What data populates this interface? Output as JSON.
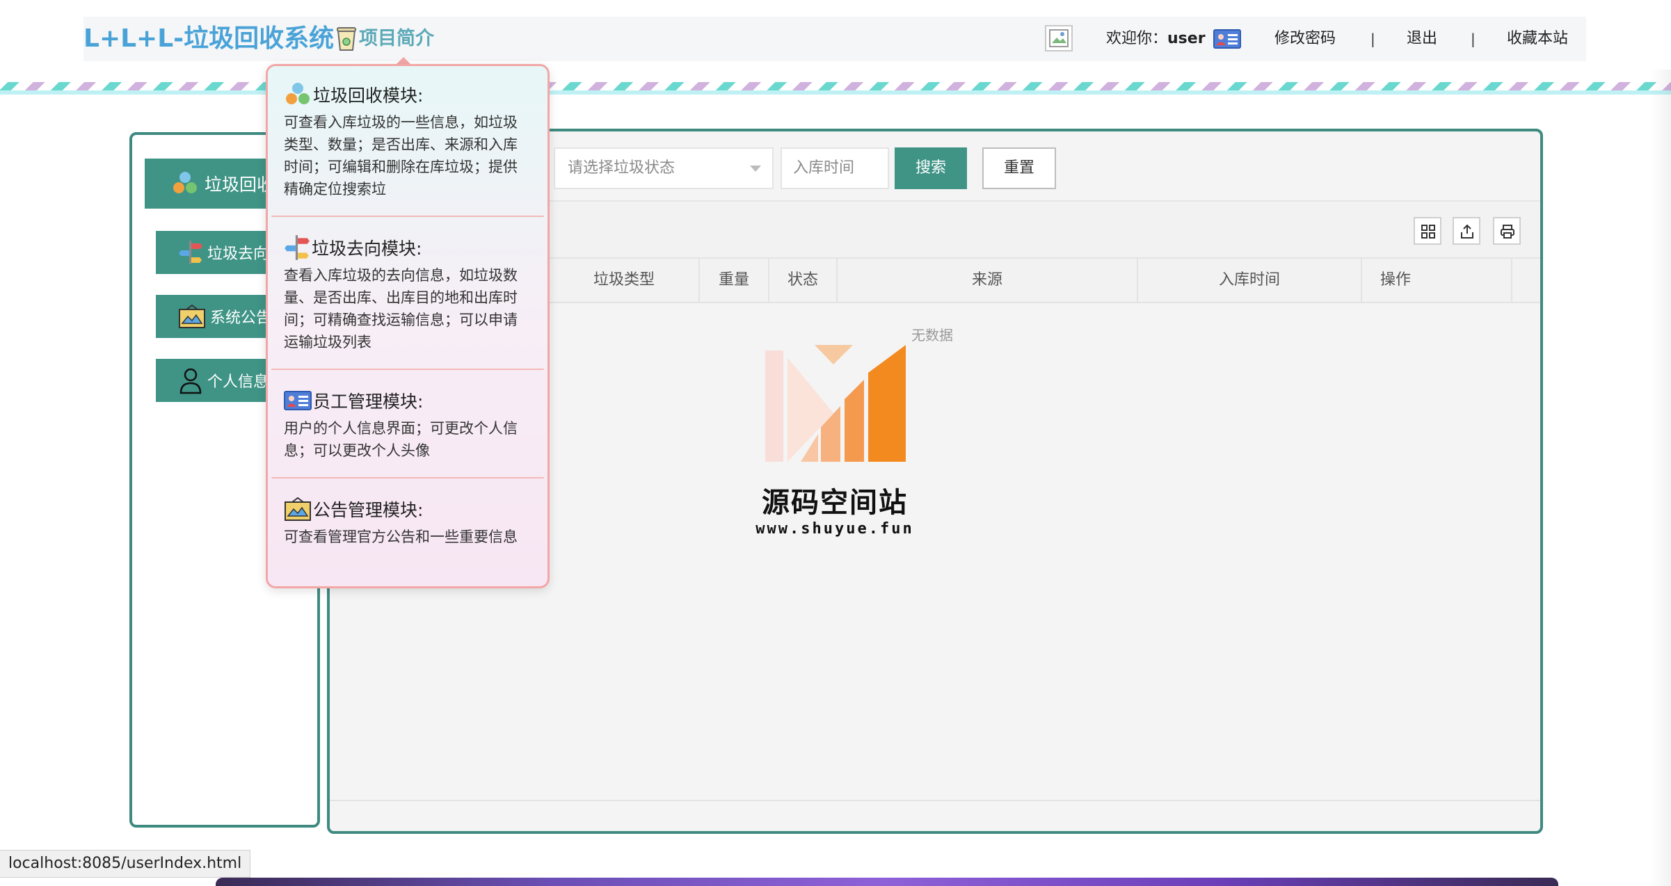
{
  "header": {
    "logo": "L+L+L-垃圾回收系统",
    "intro_link": "项目简介",
    "welcome_prefix": "欢迎你：",
    "username": "user",
    "change_password": "修改密码",
    "separator": "|",
    "logout": "退出",
    "bookmark": "收藏本站"
  },
  "sidebar": {
    "items": [
      {
        "label": "垃圾回收",
        "icon": "recycle-icon"
      },
      {
        "label": "垃圾去向",
        "icon": "signpost-icon"
      },
      {
        "label": "系统公告",
        "icon": "bulletin-icon"
      },
      {
        "label": "个人信息",
        "icon": "user-icon"
      }
    ]
  },
  "filters": {
    "status_placeholder": "请选择垃圾状态",
    "date_placeholder": "入库时间",
    "search_button": "搜索",
    "reset_button": "重置"
  },
  "table": {
    "columns": [
      "垃圾类型",
      "重量",
      "状态",
      "来源",
      "入库时间",
      "操作"
    ],
    "empty_text": "无数据",
    "toolbar_icons": [
      "columns-icon",
      "export-icon",
      "print-icon"
    ]
  },
  "watermark": {
    "title": "源码空间站",
    "url": "www.shuyue.fun"
  },
  "popover": {
    "sections": [
      {
        "title": "垃圾回收模块:",
        "icon": "recycle-icon",
        "desc": "可查看入库垃圾的一些信息，如垃圾类型、数量；是否出库、来源和入库时间；可编辑和删除在库垃圾；提供精确定位搜索垃"
      },
      {
        "title": "垃圾去向模块:",
        "icon": "signpost-icon",
        "desc": "查看入库垃圾的去向信息，如垃圾数量、是否出库、出库目的地和出库时间；可精确查找运输信息；可以申请运输垃圾列表"
      },
      {
        "title": "员工管理模块:",
        "icon": "id-card-icon",
        "desc": "用户的个人信息界面；可更改个人信息；可以更改个人头像"
      },
      {
        "title": "公告管理模块:",
        "icon": "bulletin-icon",
        "desc": "可查看管理官方公告和一些重要信息"
      }
    ]
  },
  "statusbar": {
    "url": "localhost:8085/userIndex.html"
  },
  "colors": {
    "primary": "#3f9486",
    "logo": "#4aa3d8",
    "popover_border": "#f3a6a6"
  }
}
